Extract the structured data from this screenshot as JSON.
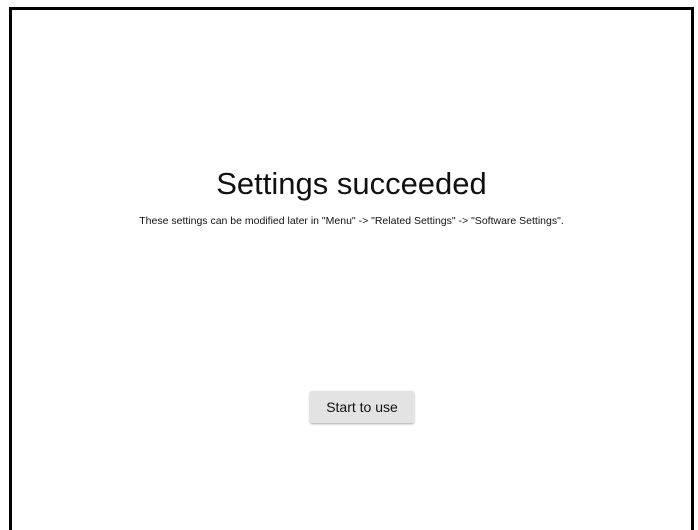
{
  "success": {
    "title": "Settings succeeded",
    "message": "These settings can be modified later in \"Menu\" -> \"Related Settings\" -> \"Software Settings\".",
    "button_label": "Start to use"
  },
  "colors": {
    "background": "#ffffff",
    "border": "#000000",
    "button_bg": "#e3e3e3",
    "text": "#111111"
  }
}
